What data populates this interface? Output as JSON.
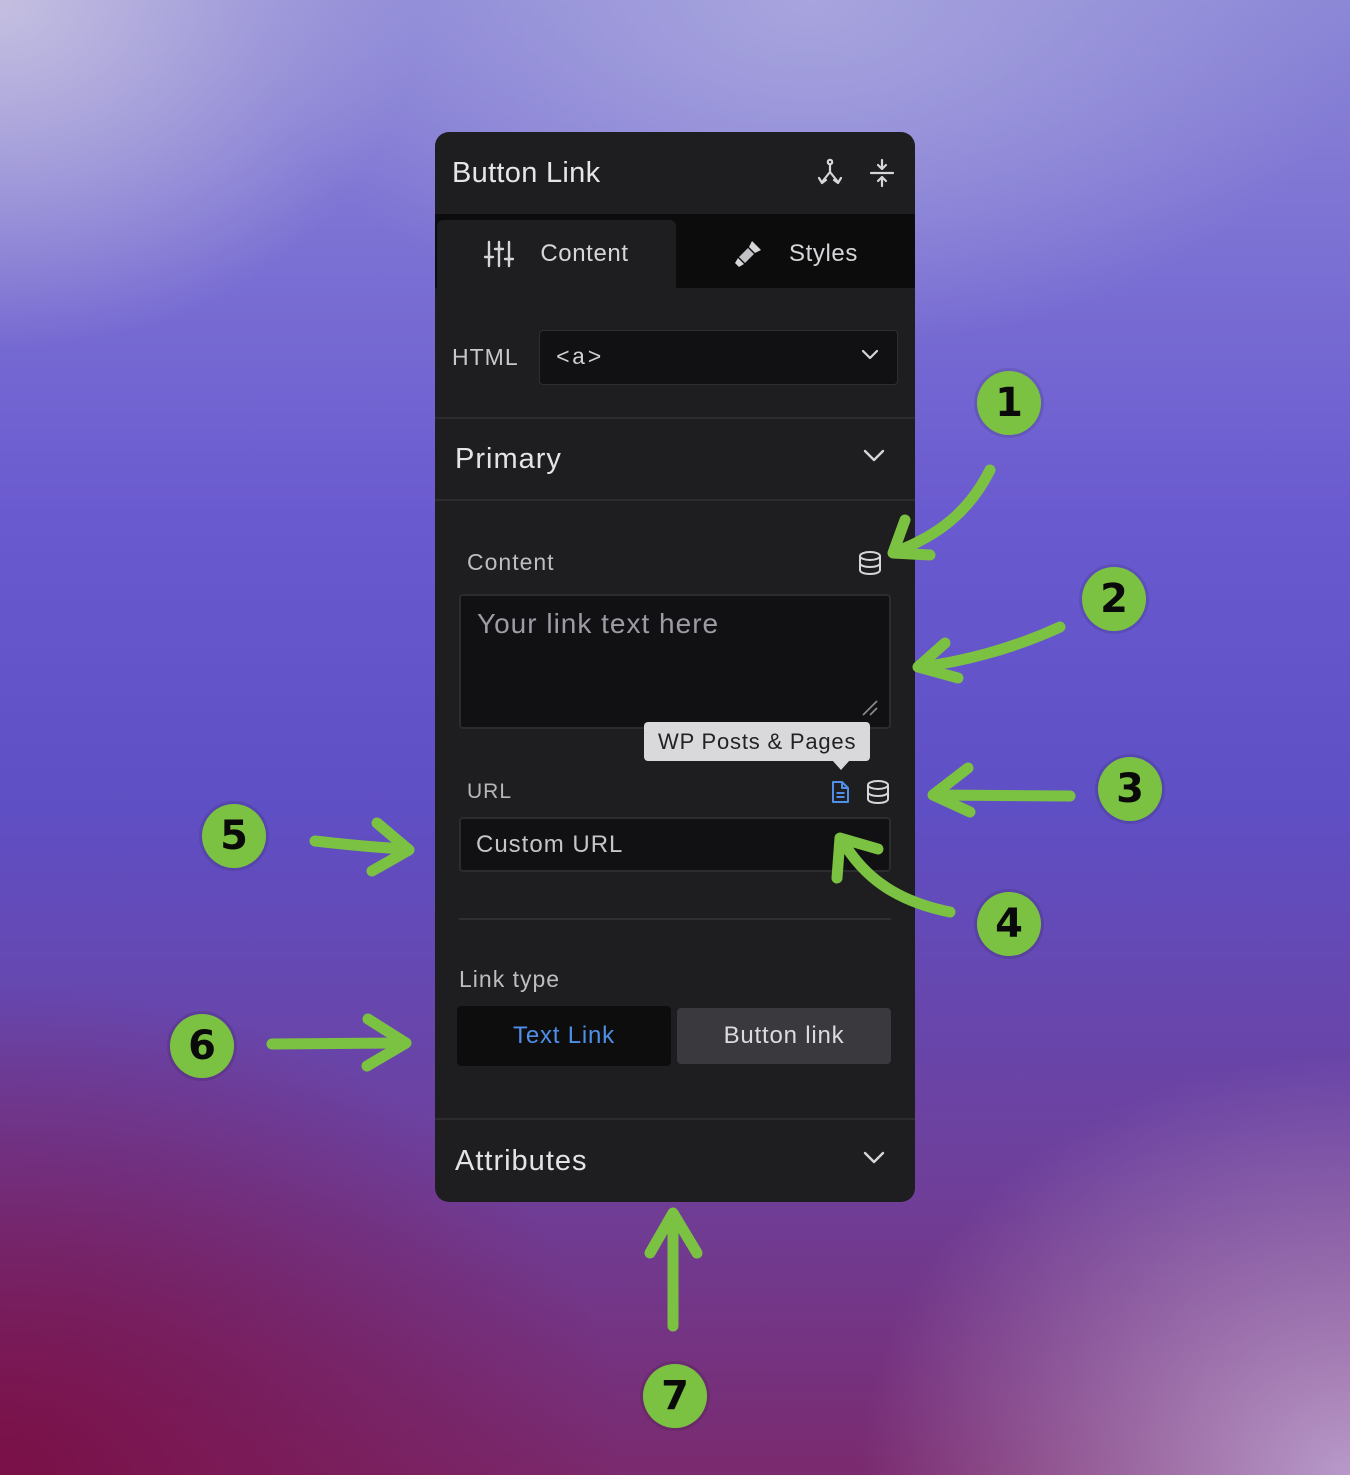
{
  "panel": {
    "title": "Button Link",
    "header_icons": [
      "branch-icon",
      "expand-vertical-icon"
    ],
    "tabs": [
      {
        "label": "Content",
        "icon": "sliders-icon",
        "active": true
      },
      {
        "label": "Styles",
        "icon": "paintbrush-icon",
        "active": false
      }
    ],
    "html_row": {
      "label": "HTML",
      "value": "<a>"
    },
    "primary_section": {
      "title": "Primary"
    },
    "content_field": {
      "label": "Content",
      "placeholder": "Your link text here",
      "icon": "database-icon"
    },
    "tooltip": "WP Posts & Pages",
    "url_field": {
      "label": "URL",
      "placeholder": "Custom URL",
      "icons": [
        "document-icon",
        "database-icon"
      ]
    },
    "link_type": {
      "label": "Link type",
      "options": [
        "Text Link",
        "Button link"
      ],
      "selected": "Text Link"
    },
    "attributes_section": {
      "title": "Attributes"
    }
  },
  "annotations": [
    "1",
    "2",
    "3",
    "4",
    "5",
    "6",
    "7"
  ],
  "colors": {
    "annotation_green": "#7cc242",
    "accent_blue": "#4f8fe8",
    "panel_bg": "#1e1e20"
  }
}
